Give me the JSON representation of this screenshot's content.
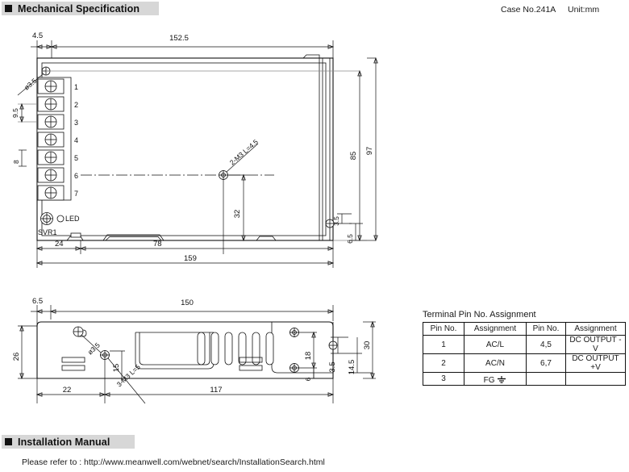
{
  "header": {
    "section1_title": "Mechanical Specification",
    "case_no": "Case No.241A",
    "unit": "Unit:mm"
  },
  "footer": {
    "section2_title": "Installation Manual",
    "note": "Please refer to : http://www.meanwell.com/webnet/search/InstallationSearch.html"
  },
  "top_view": {
    "dims": {
      "d_4_5": "4.5",
      "d_152_5": "152.5",
      "d_hole": "ø3.5",
      "d_9_5": "9.5",
      "d_8": "8",
      "d_screw": "2-M3 L=4.5",
      "d_32": "32",
      "d_85": "85",
      "d_97": "97",
      "d_3_5": "3.5",
      "d_6_5": "6.5",
      "d_24": "24",
      "d_78": "78",
      "d_159": "159"
    },
    "pins": [
      "1",
      "2",
      "3",
      "4",
      "5",
      "6",
      "7"
    ],
    "labels": {
      "led": "LED",
      "svr1": "SVR1"
    }
  },
  "side_view": {
    "dims": {
      "d_6_5": "6.5",
      "d_150": "150",
      "d_26": "26",
      "d_hole": "ø3.5",
      "d_15": "15",
      "d_22": "22",
      "d_117": "117",
      "d_18": "18",
      "d_6": "6",
      "d_3_5": "3.5",
      "d_14_5": "14.5",
      "d_30": "30",
      "d_screw": "3-M3 L=5"
    }
  },
  "pin_table": {
    "title": "Terminal Pin No.  Assignment",
    "headers": [
      "Pin No.",
      "Assignment",
      "Pin No.",
      "Assignment"
    ],
    "rows": [
      [
        "1",
        "AC/L",
        "4,5",
        "DC OUTPUT -V"
      ],
      [
        "2",
        "AC/N",
        "6,7",
        "DC OUTPUT +V"
      ],
      [
        "3",
        "FG",
        "",
        ""
      ]
    ]
  }
}
